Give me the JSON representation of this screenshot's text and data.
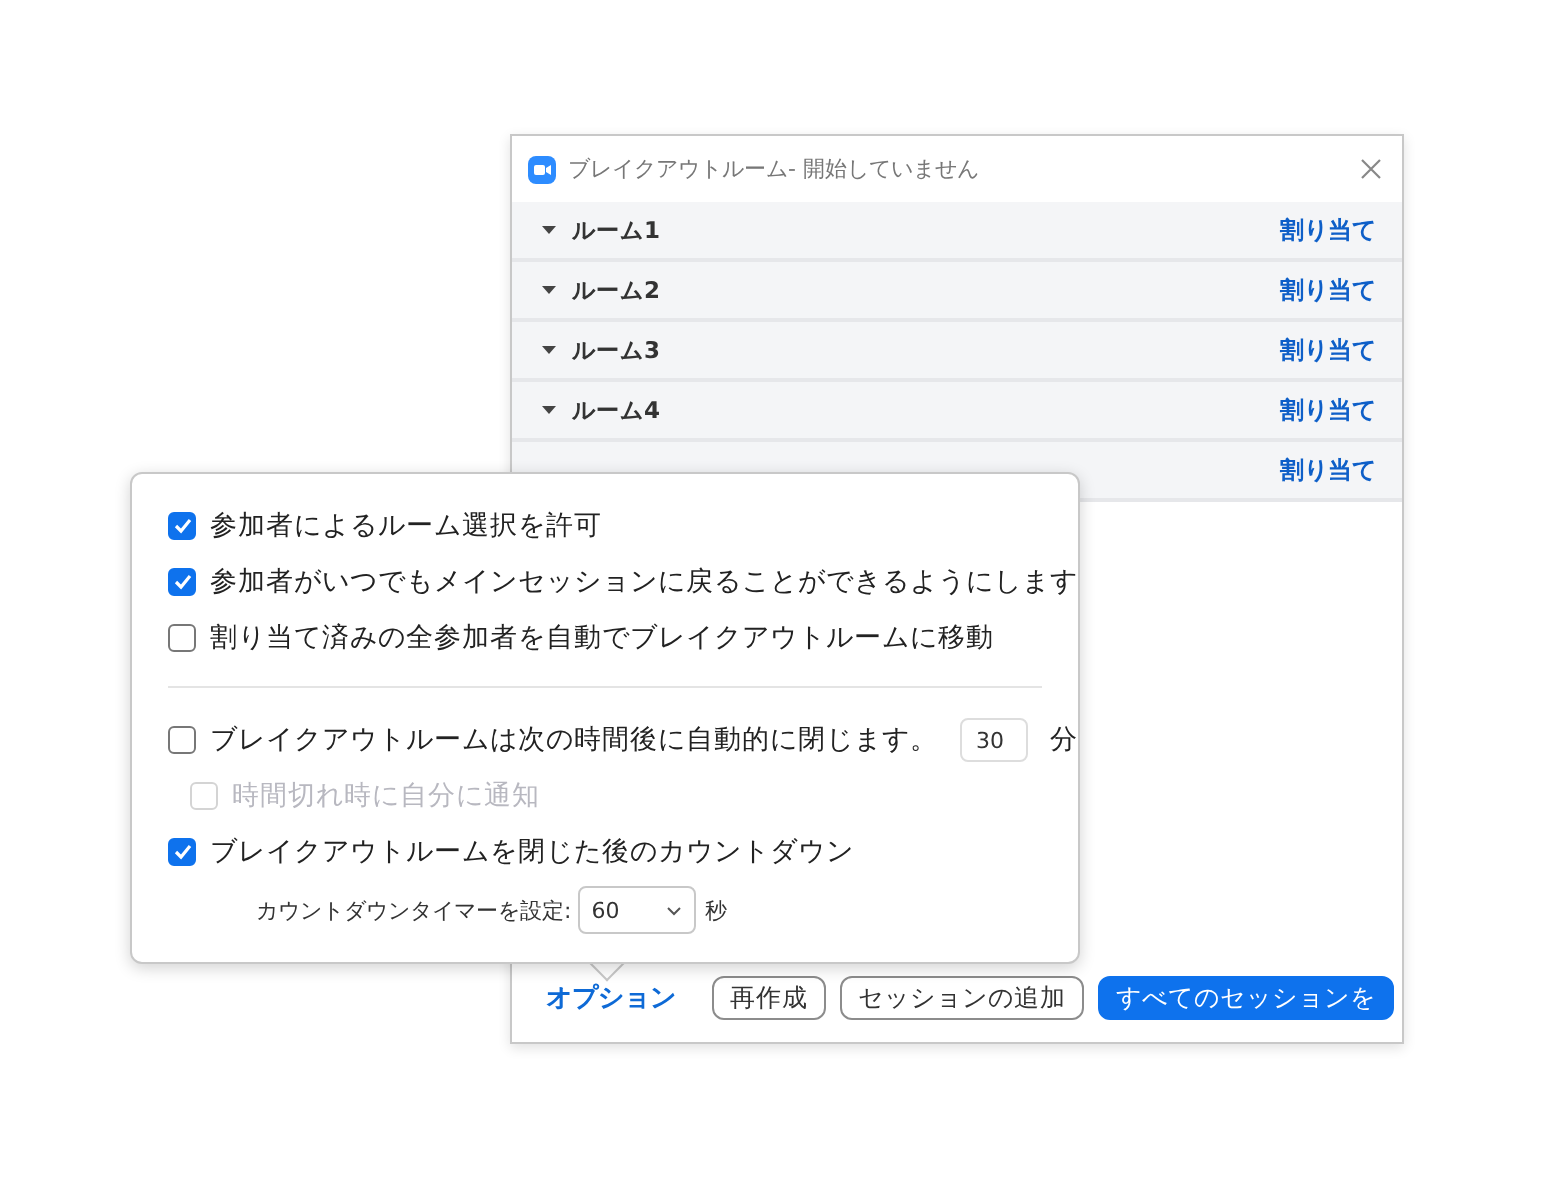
{
  "window": {
    "title": "ブレイクアウトルーム- 開始していません"
  },
  "rooms": [
    {
      "name": "ルーム1",
      "action": "割り当て"
    },
    {
      "name": "ルーム2",
      "action": "割り当て"
    },
    {
      "name": "ルーム3",
      "action": "割り当て"
    },
    {
      "name": "ルーム4",
      "action": "割り当て"
    },
    {
      "action": "割り当て"
    }
  ],
  "options_popover": {
    "sections": [
      {
        "items": [
          {
            "kind": "checkbox",
            "label": "参加者によるルーム選択を許可",
            "checked": true,
            "disabled": false
          },
          {
            "kind": "checkbox",
            "label": "参加者がいつでもメインセッションに戻ることができるようにします",
            "checked": true,
            "disabled": false
          },
          {
            "kind": "checkbox",
            "label": "割り当て済みの全参加者を自動でブレイクアウトルームに移動",
            "checked": false,
            "disabled": false
          }
        ]
      },
      {
        "items": [
          {
            "kind": "timed",
            "label": "ブレイクアウトルームは次の時間後に自動的に閉じます。",
            "checked": false,
            "disabled": false,
            "value": "30",
            "unit": "分"
          },
          {
            "kind": "sub_checkbox",
            "label": "時間切れ時に自分に通知",
            "checked": false,
            "disabled": true
          },
          {
            "kind": "checkbox",
            "label": "ブレイクアウトルームを閉じた後のカウントダウン",
            "checked": true,
            "disabled": false
          },
          {
            "kind": "select",
            "label": "カウントダウンタイマーを設定:",
            "value": "60",
            "unit": "秒"
          }
        ]
      }
    ]
  },
  "footer": {
    "options_link": "オプション",
    "buttons": [
      {
        "label": "再作成",
        "kind": "outline"
      },
      {
        "label": "セッションの追加",
        "kind": "outline"
      },
      {
        "label": "すべてのセッションを",
        "kind": "primary"
      }
    ]
  }
}
